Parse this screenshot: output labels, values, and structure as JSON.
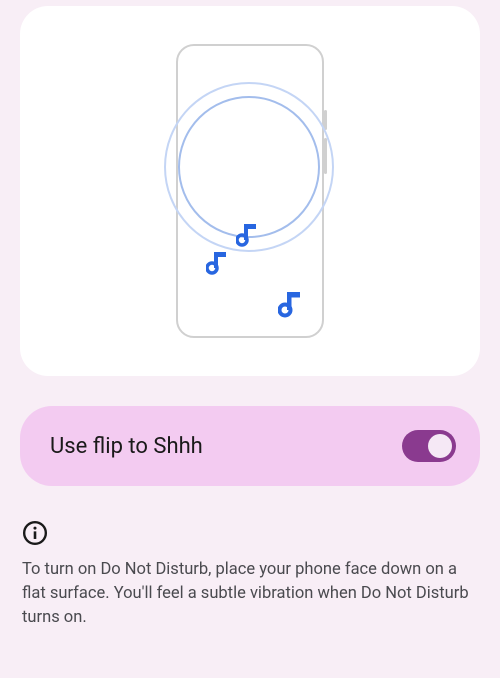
{
  "toggle": {
    "label": "Use flip to Shhh",
    "enabled": true
  },
  "info": {
    "text": "To turn on Do Not Disturb, place your phone face down on a flat surface. You'll feel a subtle vibration when Do Not Disturb turns on."
  }
}
